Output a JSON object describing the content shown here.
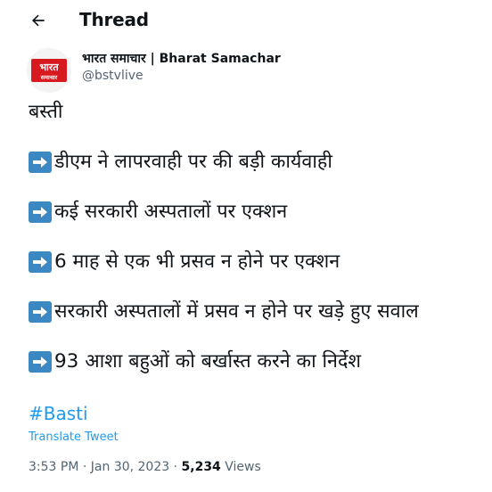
{
  "header": {
    "title": "Thread",
    "back_icon": "arrow-left-icon"
  },
  "author": {
    "display_name": "भारत समाचार | Bharat Samachar",
    "handle": "@bstvlive",
    "logo_text_top": "भारत",
    "logo_text_bottom": "समाचार",
    "logo_color": "#d71920"
  },
  "tweet": {
    "lines": [
      {
        "text": "बस्ती",
        "arrow": false
      },
      {
        "text": "डीएम ने लापरवाही पर की बड़ी कार्यवाही",
        "arrow": true
      },
      {
        "text": "कई सरकारी अस्पतालों पर एक्शन",
        "arrow": true
      },
      {
        "text": "6 माह से एक भी प्रसव न होने पर एक्शन",
        "arrow": true
      },
      {
        "text": "सरकारी अस्पतालों में प्रसव न होने पर खड़े हुए सवाल",
        "arrow": true
      },
      {
        "text": "93 आशा बहुओं को बर्खास्त करने का निर्देश",
        "arrow": true
      }
    ],
    "arrow_emoji": "right-arrow-emoji",
    "hashtag": "#Basti",
    "translate_label": "Translate Tweet"
  },
  "meta": {
    "time": "3:53 PM",
    "separator": " · ",
    "date": "Jan 30, 2023",
    "views_count": "5,234",
    "views_label": " Views"
  },
  "colors": {
    "accent": "#1d9bf0",
    "secondary_text": "#536471",
    "primary_text": "#0f1419",
    "emoji_blue": "#3b88c3"
  }
}
